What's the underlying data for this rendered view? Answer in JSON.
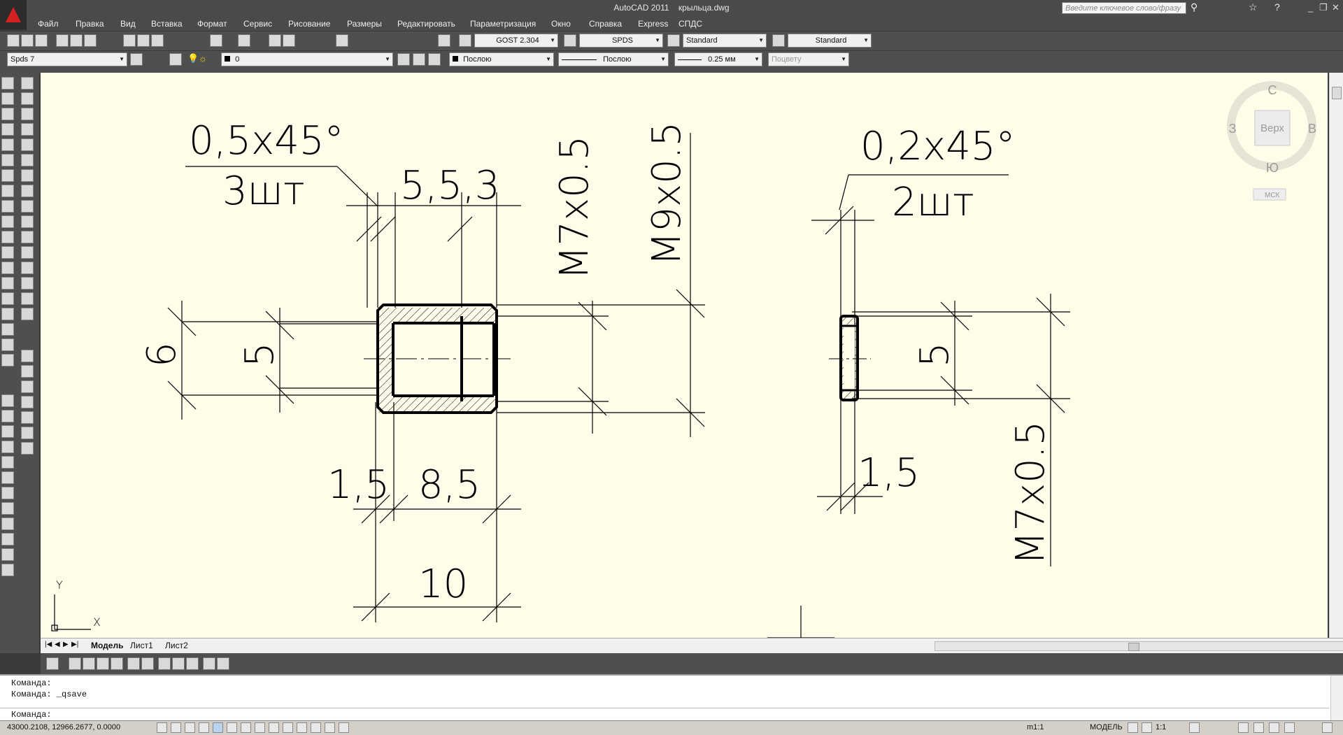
{
  "title_bar": {
    "app_title": "AutoCAD 2011",
    "file_name": "крыльца.dwg",
    "search_placeholder": "Введите ключевое слово/фразу"
  },
  "menu": [
    "Файл",
    "Правка",
    "Вид",
    "Вставка",
    "Формат",
    "Сервис",
    "Рисование",
    "Размеры",
    "Редактировать",
    "Параметризация",
    "Окно",
    "Справка",
    "Express",
    "СПДС"
  ],
  "toolbar_styles": {
    "text_style": "GOST 2.304",
    "dim_style": "SPDS",
    "table_style": "Standard",
    "mleader_style": "Standard"
  },
  "toolbar_layers": {
    "workspace": "Spds 7",
    "layer": "0",
    "color": "Послою",
    "linetype": "Послою",
    "lineweight": "0.25 мм",
    "plot_style": "Поцвету"
  },
  "drawing": {
    "left_part": {
      "chamfer_note": "0,5x45°",
      "chamfer_count": "3шт",
      "top_dims": "5,5,3",
      "thread_inner": "M7x0.5",
      "thread_outer": "M9x0.5",
      "dim_6": "6",
      "dim_5": "5",
      "dim_1_5": "1,5",
      "dim_8_5": "8,5",
      "dim_10": "10"
    },
    "right_part": {
      "chamfer_note": "0,2x45°",
      "chamfer_count": "2шт",
      "dim_5": "5",
      "dim_1_5": "1,5",
      "thread": "M7x0.5"
    },
    "ucs": {
      "x_label": "X",
      "y_label": "Y"
    }
  },
  "viewcube": {
    "north": "С",
    "south": "Ю",
    "west": "З",
    "east": "В",
    "face": "Верх",
    "ucs_menu": "МСК"
  },
  "layout_tabs": [
    "Модель",
    "Лист1",
    "Лист2"
  ],
  "command_history": [
    "Команда:",
    "Команда: _qsave"
  ],
  "command_prompt": "Команда:",
  "status": {
    "coordinates": "43000.2108, 12966.2677, 0.0000",
    "annotation_scale_ratio": "m1:1",
    "space": "МОДЕЛЬ",
    "scale": "1:1"
  },
  "colors": {
    "canvas": "#fffdea",
    "ui_dark": "#4a4a4a",
    "logo_red": "#d42020"
  }
}
